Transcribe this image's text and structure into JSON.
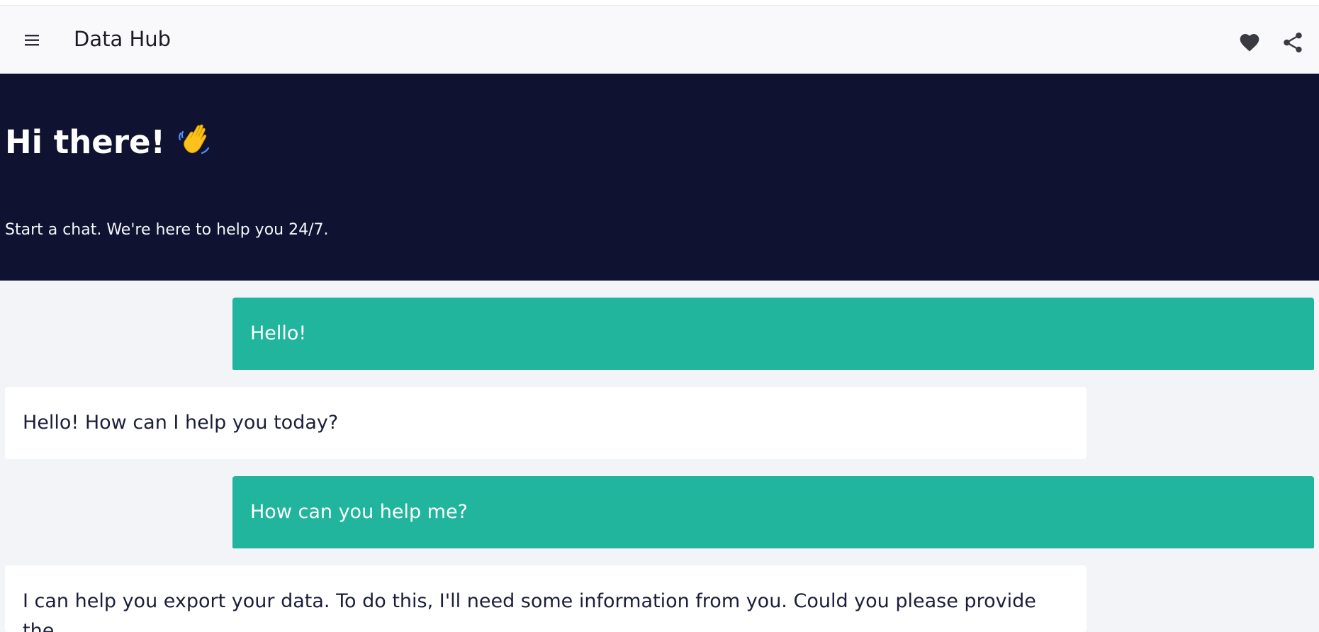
{
  "app": {
    "title": "Data Hub",
    "icons": {
      "menu": "menu-icon",
      "favorite": "heart-icon",
      "share": "share-icon"
    }
  },
  "hero": {
    "title": "Hi there!",
    "emoji": "waving-hand-icon",
    "subtitle": "Start a chat. We're here to help you 24/7.",
    "background": "#0f1331"
  },
  "colors": {
    "user_bubble": "#20b59c",
    "bot_bubble": "#ffffff",
    "page_background": "#f3f4f7"
  },
  "messages": [
    {
      "role": "user",
      "text": "Hello!"
    },
    {
      "role": "bot",
      "text": "Hello! How can I help you today?"
    },
    {
      "role": "user",
      "text": "How can you help me?"
    },
    {
      "role": "bot",
      "text": "I can help you export your data. To do this, I'll need some information from you. Could you please provide the"
    }
  ]
}
